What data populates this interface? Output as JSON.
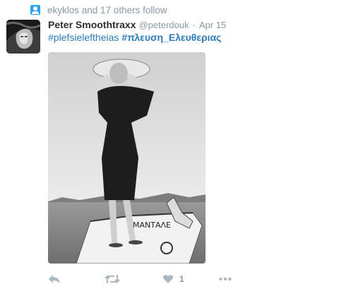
{
  "context": {
    "text": "ekyklos and 17 others follow",
    "icon": "follow-person-icon"
  },
  "tweet": {
    "fullname": "Peter Smoothtraxx",
    "username": "@peterdouk",
    "separator": "·",
    "time": "Apr 15",
    "hashtags": [
      "#plefsieleftheias",
      "#πλευση_Ελευθεριας"
    ],
    "photo_caption_text": "ΜΑΝΤΑΛΕ"
  },
  "actions": {
    "reply_icon": "reply-icon",
    "retweet_icon": "retweet-icon",
    "like_icon": "heart-icon",
    "like_count": "1",
    "more_icon": "more-dots-icon"
  },
  "colors": {
    "link": "#2b7bb9",
    "muted": "#8899a6",
    "icon": "#aab8c2",
    "accent": "#2aa3ef"
  }
}
